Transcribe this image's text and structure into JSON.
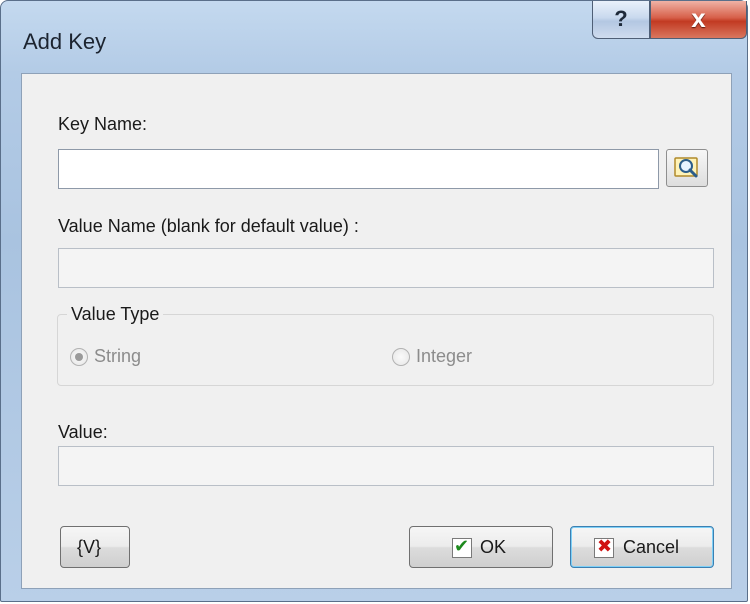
{
  "window": {
    "title": "Add Key",
    "help_glyph": "?",
    "close_glyph": "x"
  },
  "fields": {
    "key_name_label": "Key Name:",
    "key_name_value": "",
    "value_name_label": "Value Name (blank for default value) :",
    "value_name_value": "",
    "value_label": "Value:",
    "value_value": ""
  },
  "value_type": {
    "legend": "Value Type",
    "options": [
      {
        "label": "String",
        "selected": true
      },
      {
        "label": "Integer",
        "selected": false
      }
    ]
  },
  "buttons": {
    "variables_label": "{V}",
    "ok_label": "OK",
    "cancel_label": "Cancel"
  },
  "icons": {
    "browse": "magnifier-icon",
    "ok": "checkmark-icon",
    "cancel": "red-x-icon"
  },
  "colors": {
    "title_bar": "#b3cbe6",
    "close_button": "#c23a22",
    "dialog_bg": "#f0f0f0",
    "ok_check": "#1e8a1e",
    "cancel_x": "#d01010"
  }
}
